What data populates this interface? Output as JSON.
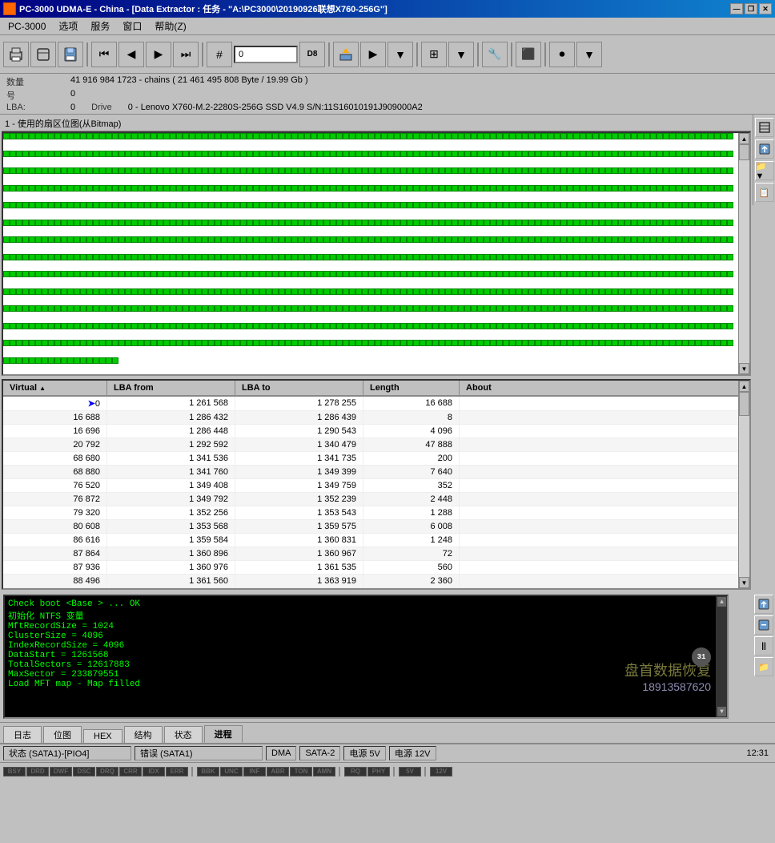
{
  "titleBar": {
    "appName": "PC-3000 UDMA-E - China - [Data Extractor : 任务 - \"A:\\PC3000\\20190926联想X760-256G\"]",
    "minimize": "—",
    "restore": "❐",
    "close": "✕"
  },
  "menuBar": {
    "items": [
      "PC-3000",
      "选项",
      "服务",
      "窗口",
      "帮助(Z)"
    ]
  },
  "infoBar": {
    "countLabel": "数量",
    "countValue": "41 916 984   1723 - chains  ( 21 461 495 808 Byte /  19.99 Gb )",
    "numLabel": "号",
    "numValue": "0",
    "lbaLabel": "LBA:",
    "lbaValue": "0",
    "driveLabel": "Drive",
    "driveValue": "0 - Lenovo X760-M.2-2280S-256G SSD V4.9 S/N:11S16010191J909000A2"
  },
  "bitmapSection": {
    "label": "1 - 使用的扇区位图(从Bitmap)",
    "cellCount": 1200,
    "scrollUpArrow": "▲",
    "scrollDownArrow": "▼"
  },
  "table": {
    "headers": [
      "Virtual",
      "LBA from",
      "LBA to",
      "Length",
      "About"
    ],
    "rows": [
      {
        "indicator": "➤",
        "virtual": "0",
        "lbaFrom": "1 261 568",
        "lbaTo": "1 278 255",
        "length": "16 688",
        "about": ""
      },
      {
        "indicator": "",
        "virtual": "16 688",
        "lbaFrom": "1 286 432",
        "lbaTo": "1 286 439",
        "length": "8",
        "about": ""
      },
      {
        "indicator": "",
        "virtual": "16 696",
        "lbaFrom": "1 286 448",
        "lbaTo": "1 290 543",
        "length": "4 096",
        "about": ""
      },
      {
        "indicator": "",
        "virtual": "20 792",
        "lbaFrom": "1 292 592",
        "lbaTo": "1 340 479",
        "length": "47 888",
        "about": ""
      },
      {
        "indicator": "",
        "virtual": "68 680",
        "lbaFrom": "1 341 536",
        "lbaTo": "1 341 735",
        "length": "200",
        "about": ""
      },
      {
        "indicator": "",
        "virtual": "68 880",
        "lbaFrom": "1 341 760",
        "lbaTo": "1 349 399",
        "length": "7 640",
        "about": ""
      },
      {
        "indicator": "",
        "virtual": "76 520",
        "lbaFrom": "1 349 408",
        "lbaTo": "1 349 759",
        "length": "352",
        "about": ""
      },
      {
        "indicator": "",
        "virtual": "76 872",
        "lbaFrom": "1 349 792",
        "lbaTo": "1 352 239",
        "length": "2 448",
        "about": ""
      },
      {
        "indicator": "",
        "virtual": "79 320",
        "lbaFrom": "1 352 256",
        "lbaTo": "1 353 543",
        "length": "1 288",
        "about": ""
      },
      {
        "indicator": "",
        "virtual": "80 608",
        "lbaFrom": "1 353 568",
        "lbaTo": "1 359 575",
        "length": "6 008",
        "about": ""
      },
      {
        "indicator": "",
        "virtual": "86 616",
        "lbaFrom": "1 359 584",
        "lbaTo": "1 360 831",
        "length": "1 248",
        "about": ""
      },
      {
        "indicator": "",
        "virtual": "87 864",
        "lbaFrom": "1 360 896",
        "lbaTo": "1 360 967",
        "length": "72",
        "about": ""
      },
      {
        "indicator": "",
        "virtual": "87 936",
        "lbaFrom": "1 360 976",
        "lbaTo": "1 361 535",
        "length": "560",
        "about": ""
      },
      {
        "indicator": "",
        "virtual": "88 496",
        "lbaFrom": "1 361 560",
        "lbaTo": "1 363 919",
        "length": "2 360",
        "about": ""
      }
    ]
  },
  "logSection": {
    "lines": [
      "Check boot <Base   > ... OK",
      "初始化 NTFS 变量",
      "    MftRecordSize  = 1024",
      "    ClusterSize    = 4096",
      "    IndexRecordSize = 4096",
      "    DataStart      = 1261568",
      "    TotalSectors   = 12617883",
      "    MaxSector      = 233879551",
      "    Load MFT map   - Map filled"
    ],
    "watermark": "盘首数据恢复",
    "watermarkPhone": "18913587620"
  },
  "tabs": [
    {
      "label": "日志",
      "active": false
    },
    {
      "label": "位图",
      "active": false
    },
    {
      "label": "HEX",
      "active": false
    },
    {
      "label": "结构",
      "active": false
    },
    {
      "label": "状态",
      "active": false
    },
    {
      "label": "进程",
      "active": true
    }
  ],
  "statusBar": {
    "sata1State": "状态 (SATA1)-[PIO4]",
    "sata1Error": "错误 (SATA1)",
    "dma": "DMA",
    "sata2": "SATA-2",
    "power5v": "电源 5V",
    "power12v": "电源 12V",
    "time": "12:31"
  },
  "ledBar1": {
    "leds": [
      "BSY",
      "DRD",
      "DWF",
      "DSC",
      "DRQ",
      "CRR",
      "IDX",
      "ERR"
    ]
  },
  "ledBar2": {
    "leds": [
      "BBK",
      "UNC",
      "INF",
      "ABR",
      "TON",
      "AMN"
    ]
  },
  "ledBar3": {
    "leds": [
      "RQ",
      "PHY"
    ]
  },
  "ledBar4": {
    "leds": [
      "5V"
    ]
  },
  "ledBar5": {
    "leds": [
      "12V"
    ]
  },
  "sideButtons": {
    "bitmap": [
      "⬆",
      "💾",
      "📁",
      "📋"
    ],
    "log": [
      "💾",
      "💾",
      "||",
      "📁"
    ]
  },
  "badgeNumber": "31"
}
